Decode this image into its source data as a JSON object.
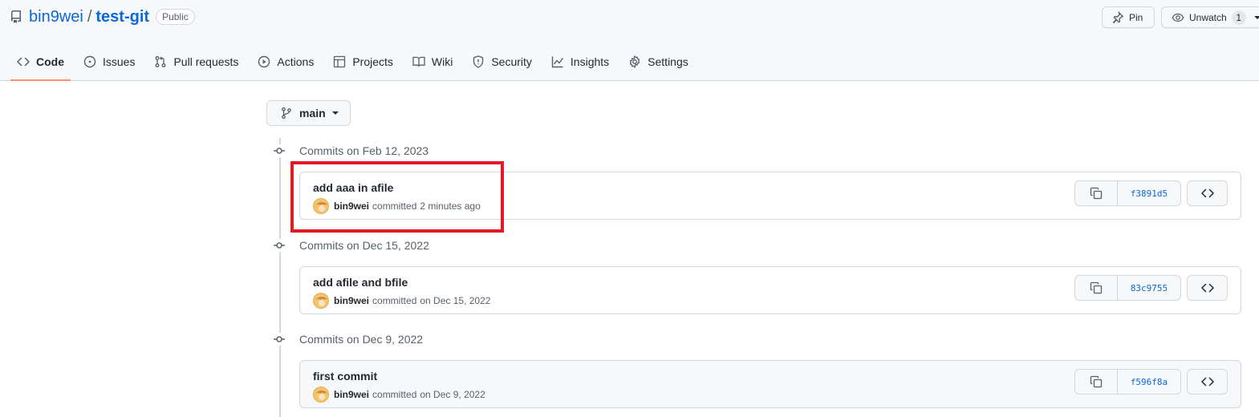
{
  "repo": {
    "owner": "bin9wei",
    "separator": "/",
    "name": "test-git",
    "visibility": "Public"
  },
  "header_actions": {
    "pin_label": "Pin",
    "watch_label": "Unwatch",
    "watch_count": "1"
  },
  "tabs": [
    {
      "label": "Code",
      "icon": "code-icon",
      "active": true
    },
    {
      "label": "Issues",
      "icon": "issue-icon"
    },
    {
      "label": "Pull requests",
      "icon": "pull-request-icon"
    },
    {
      "label": "Actions",
      "icon": "play-icon"
    },
    {
      "label": "Projects",
      "icon": "table-icon"
    },
    {
      "label": "Wiki",
      "icon": "book-icon"
    },
    {
      "label": "Security",
      "icon": "shield-icon"
    },
    {
      "label": "Insights",
      "icon": "graph-icon"
    },
    {
      "label": "Settings",
      "icon": "gear-icon"
    }
  ],
  "branch": {
    "label": "main"
  },
  "commit_groups": [
    {
      "heading": "Commits on Feb 12, 2023",
      "commits": [
        {
          "message": "add aaa in afile",
          "author": "bin9wei",
          "verb": "committed",
          "time": "2 minutes ago",
          "sha": "f3891d5"
        }
      ]
    },
    {
      "heading": "Commits on Dec 15, 2022",
      "commits": [
        {
          "message": "add afile and bfile",
          "author": "bin9wei",
          "verb": "committed",
          "time": "on Dec 15, 2022",
          "sha": "83c9755"
        }
      ]
    },
    {
      "heading": "Commits on Dec 9, 2022",
      "commits": [
        {
          "message": "first commit",
          "author": "bin9wei",
          "verb": "committed",
          "time": "on Dec 9, 2022",
          "sha": "f596f8a"
        }
      ]
    }
  ],
  "colors": {
    "link": "#0969da",
    "active_tab_underline": "#fd8c73",
    "highlight_box": "#e01b24"
  }
}
